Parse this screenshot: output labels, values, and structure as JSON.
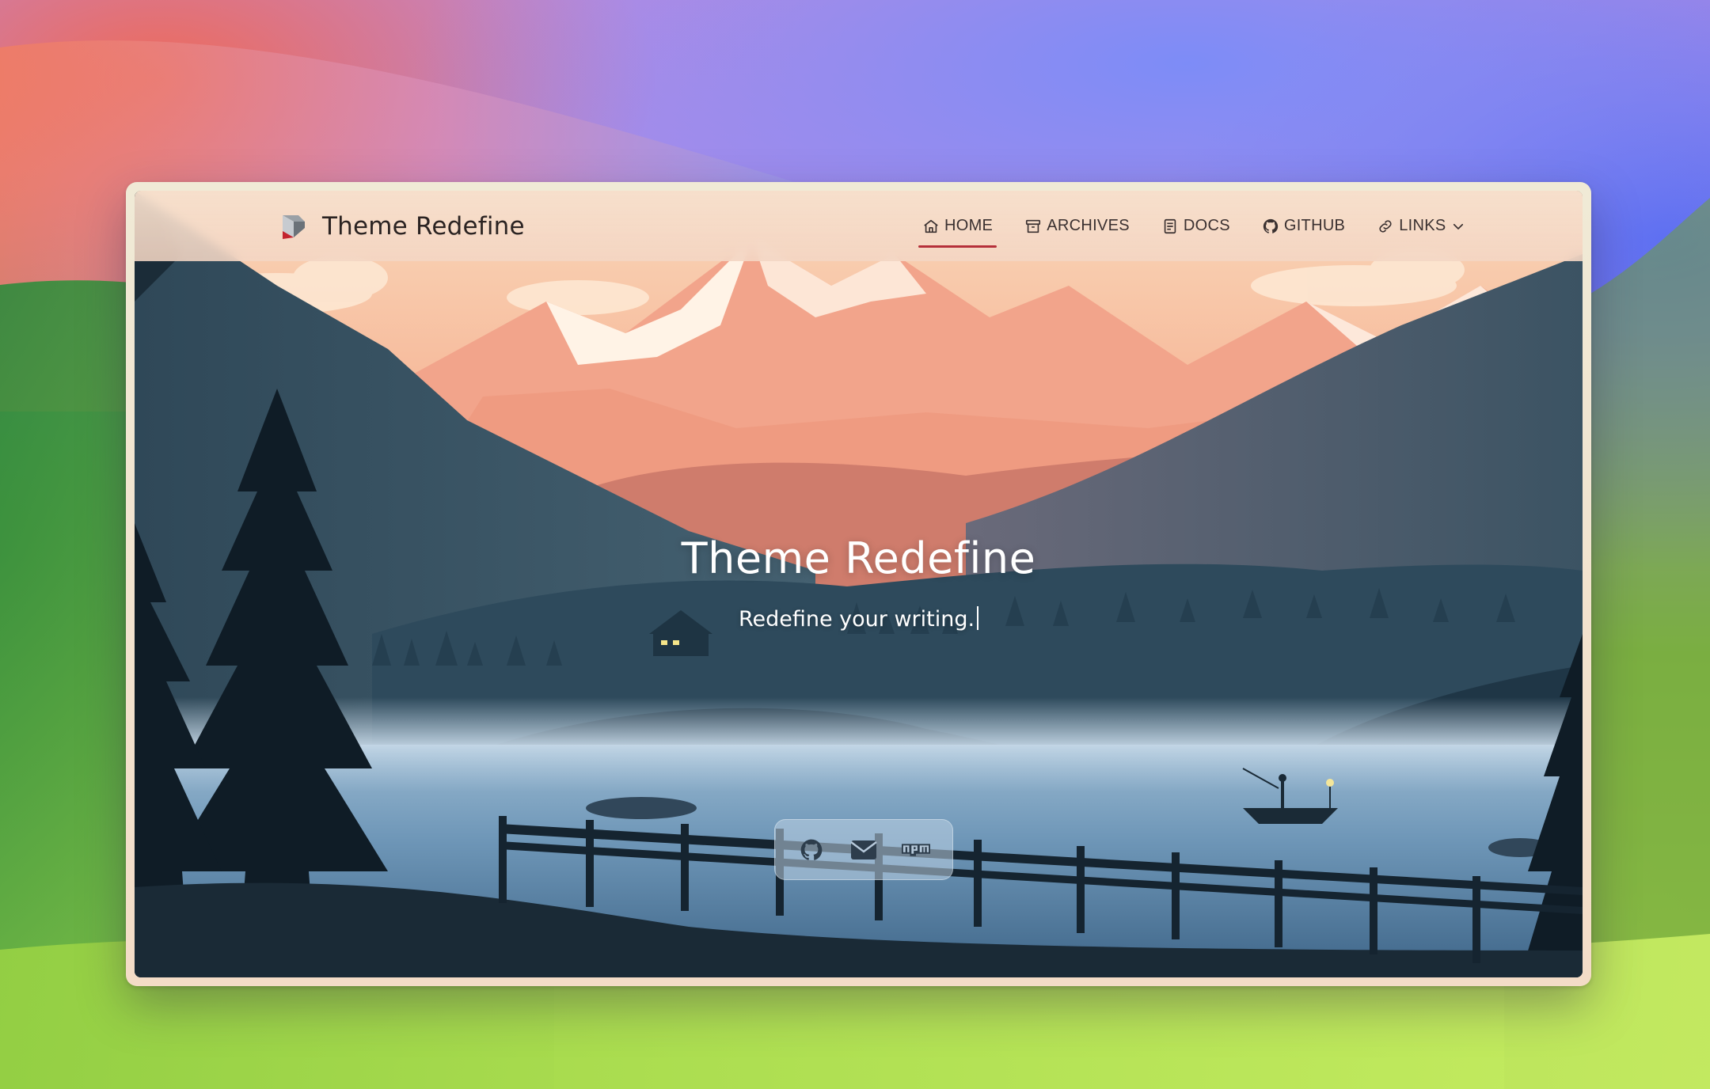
{
  "site": {
    "brand_name": "Theme Redefine"
  },
  "nav": {
    "items": [
      {
        "label": "HOME",
        "icon": "house-icon",
        "active": true
      },
      {
        "label": "ARCHIVES",
        "icon": "archive-box-icon",
        "active": false
      },
      {
        "label": "DOCS",
        "icon": "book-icon",
        "active": false
      },
      {
        "label": "GITHUB",
        "icon": "github-icon",
        "active": false
      },
      {
        "label": "LINKS",
        "icon": "link-icon",
        "active": false,
        "has_dropdown": true
      }
    ],
    "accent_color": "#b5303a"
  },
  "hero": {
    "title": "Theme Redefine",
    "subtitle": "Redefine your writing."
  },
  "social": {
    "items": [
      "github-icon",
      "envelope-icon",
      "npm-icon"
    ]
  }
}
